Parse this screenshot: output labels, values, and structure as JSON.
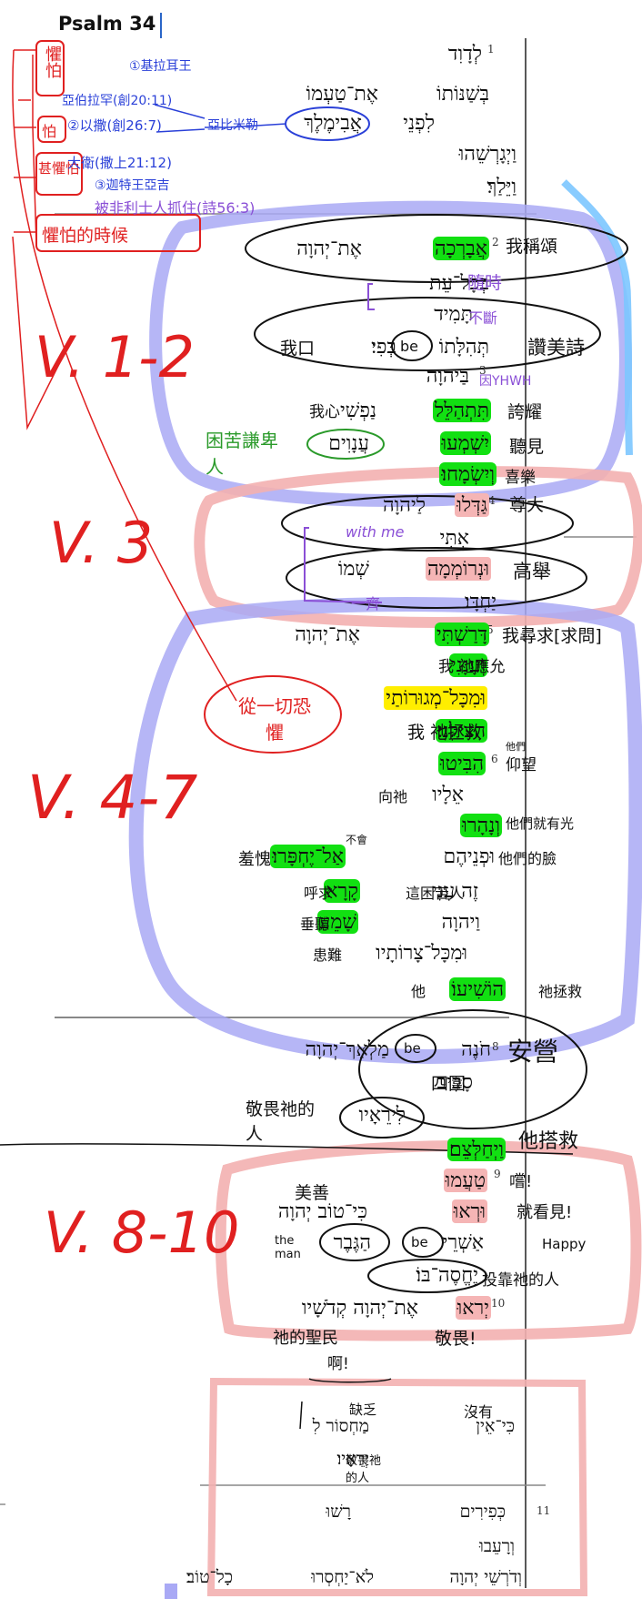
{
  "title": "Psalm 34",
  "verse_numbers": [
    "1",
    "2",
    "3",
    "4",
    "5",
    "6",
    "7",
    "8",
    "9",
    "10",
    "11"
  ],
  "hebrew": {
    "l1": "לְדָוִד",
    "l2a": "אֶת־טַעְמוֹ",
    "l2b": "בְּשַׁנּוֹתוֹ",
    "l3a": "אֲבִימֶלֶךְ",
    "l3b": "לִפְנֵי",
    "l4": "וַיְגָרְשֵׁהוּ",
    "l5": "וַיֵּלַךְ׃",
    "l6a": "אֶת־יְהוָה",
    "l6b": "אֲבָרְכָה",
    "l7": "בְּכָל־עֵת",
    "l8": "תָּמִיד",
    "l9a": "תְּהִלָּתוֹ",
    "l9b": "בְּפִי׃",
    "l10": "בַּיהוָה",
    "l11a": "נַפְשִׁי",
    "l11b": "תִּתְהַלֵּל",
    "l12a": "עֲנָוִים",
    "l12b": "יִשְׁמְעוּ",
    "l13": "וְיִשְׂמָחוּ׃",
    "l14a": "לַיהוָה",
    "l14b": "גַּדְּלוּ",
    "l15": "אִתִּי",
    "l16a": "שְׁמוֹ",
    "l16b": "וּנְרוֹמְמָה",
    "l17": "יַחְדָּו׃",
    "l18a": "אֶת־יְהוָה",
    "l18b": "דָּרַשְׁתִּי",
    "l19": "וְעָנָנִי",
    "l20": "וּמִכָּל־מְגוּרוֹתַי",
    "l21": "הִצִּילָנִי׃",
    "l22": "הִבִּיטוּ",
    "l23": "אֵלָיו",
    "l24": "וְנָהָרוּ",
    "l25a": "אַל־יֶחְפָּרוּ׃",
    "l25b": "וּפְנֵיהֶם",
    "l26a": "קָרָא",
    "l26b": "זֶה עָנִי",
    "l27a": "שָׁמֵעַ",
    "l27b": "וַיהוָה",
    "l28": "וּמִכָּל־צָרוֹתָיו",
    "l29": "הוֹשִׁיעוֹ׃",
    "l30a": "מַלְאַךְ־יְהוָה",
    "l30b": "חֹנֶה",
    "l31": "סָבִיב",
    "l32": "לִירֵאָיו",
    "l33a": "וַיְחַלְּצֵם׃",
    "l34": "טַעֲמוּ",
    "l35a": "כִּי־טוֹב יְהוָה",
    "l35b": "וּרְאוּ",
    "l36a": "הַגֶּבֶר",
    "l36b": "אַשְׁרֵי",
    "l37": "יֶחֱסֶה־בּוֹ׃",
    "l38a": "אֶת־יְהוָה קְדֹשָׁיו",
    "l38b": "יְראוּ",
    "l39a": "מַחְסוֹר לִ",
    "l39b": "כִּי־אֵין",
    "l40": "יְרֵאָיו׃",
    "l41a": "רָשׁוּ",
    "l41b": "כְּפִירִים",
    "l42": "וְרָעֵבוּ",
    "l43a": "כָל־טוֹב׃",
    "l43b": "לֹא־יַחְסְרוּ",
    "l43c": "וְדֹרְשֵׁי יְהוָה"
  },
  "annotations": {
    "fear_box": "懼怕",
    "note_a1": "①基拉耳王",
    "note_a2": "亞伯拉罕(創20:11)",
    "note_a3": "②以撒(創26:7)",
    "note_a4": "亞比米勒",
    "note_b1": "大衛(撒上21:12)",
    "note_b2": "③迦特王亞吉",
    "note_b3": "被非利士人抓住(詩56:3)",
    "fear_time": "懼怕的時候",
    "fear_label2": "怕",
    "fear_label3": "甚懼怕",
    "g_bless": "我稱頌",
    "g_always": "隨時",
    "g_cont": "不斷",
    "g_praise": "讚美詩",
    "g_mouth": "我口",
    "g_be": "be",
    "g_yhwh": "因YHWH",
    "g_boast": "誇耀",
    "g_mysoul": "我心",
    "g_humble": "困苦謙卑人",
    "g_hear": "聽見",
    "g_glad": "喜樂",
    "g_magnify": "尊大",
    "g_with": "with me",
    "g_exalt": "高舉",
    "g_together": "一齊",
    "g_seek": "我尋求[求問]",
    "g_answer": "我 祂應允",
    "g_allfear": "從一切恐懼",
    "g_save": "我 祂拯救",
    "g_look": "仰望",
    "g_they": "他們",
    "g_tohim": "向祂",
    "g_radiant": "他們就有光",
    "g_not": "不會",
    "g_shame": "羞愧",
    "g_faces": "他們的臉",
    "g_cry": "呼求",
    "g_poor": "這困苦人",
    "g_heard": "垂聽",
    "g_trouble": "患難",
    "g_he": "他",
    "g_saves": "祂拯救",
    "g_camp": "安營",
    "g_around": "四圍",
    "g_fearers": "敬畏祂的人",
    "g_deliver": "他搭救",
    "g_taste": "嚐!",
    "g_see": "就看見!",
    "g_good": "美善",
    "g_the_man": "the man",
    "g_happy": "Happy",
    "g_trust": "投靠祂的人",
    "g_saints": "祂的聖民",
    "g_oh": "啊!",
    "g_fear_v": "敬畏!",
    "g_lack": "缺乏",
    "g_none": "沒有",
    "g_fear_him": "敬畏祂的人",
    "v12": "V. 1-2",
    "v3": "V. 3",
    "v47": "V. 4-7",
    "v810": "V. 8-10"
  },
  "colors": {
    "highlight_green": "#12e012",
    "highlight_yellow": "#ffee00",
    "bubble_blue": "#8f8ff0",
    "bubble_pink": "#f0a0a0",
    "ink_red": "#e02020",
    "ink_purple": "#8a4fd6"
  }
}
